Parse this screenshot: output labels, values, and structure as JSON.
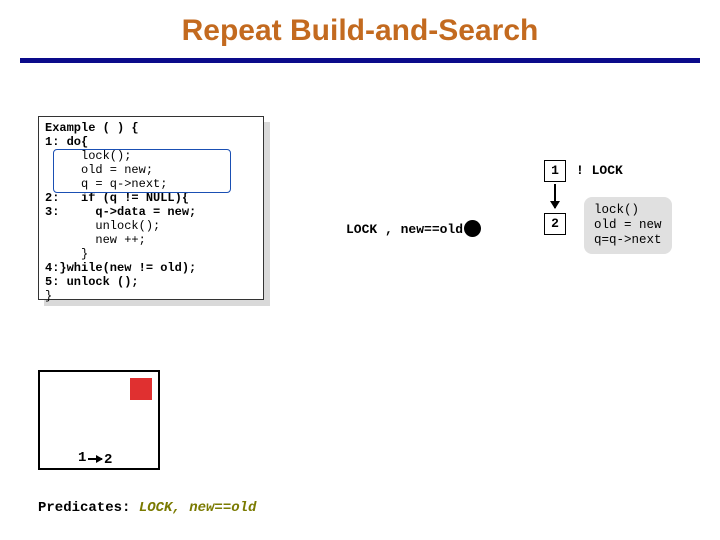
{
  "title": "Repeat Build-and-Search",
  "code": {
    "l1": "Example ( ) {",
    "l2": "1: do{",
    "l3": "     lock();",
    "l4": "     old = new;",
    "l5": "     q = q->next;",
    "l6": "2:   if (q != NULL){",
    "l7": "3:     q->data = new;",
    "l8": "       unlock();",
    "l9": "       new ++;",
    "l10": "     }",
    "l11": "4:}while(new != old);",
    "l12": "5: unlock ();",
    "l13": "}"
  },
  "graph": {
    "node1": "1",
    "node2": "2",
    "label_notlock": "! LOCK",
    "label_lockeq": "LOCK , new==old",
    "side_l1": "lock()",
    "side_l2": "old = new",
    "side_l3": "q=q->next"
  },
  "mini": {
    "n1": "1",
    "n2": "2"
  },
  "predicates": {
    "label": "Predicates:",
    "val": " LOCK, new==old"
  }
}
